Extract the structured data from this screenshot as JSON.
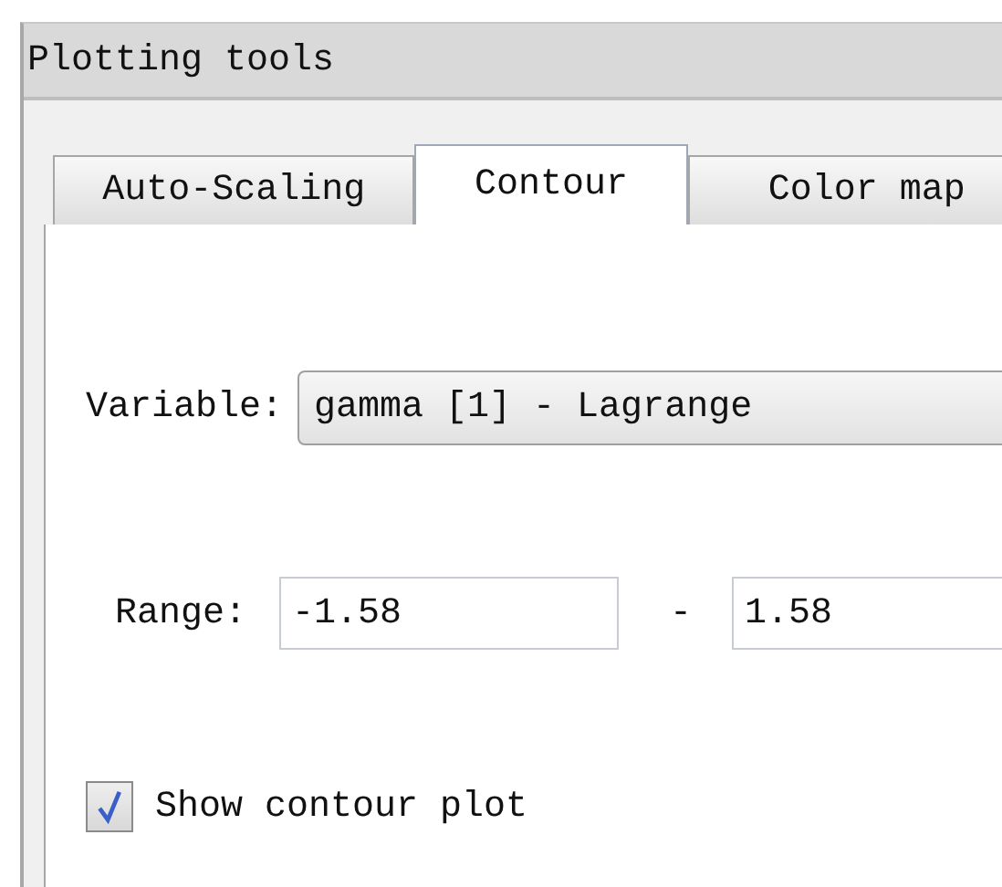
{
  "window": {
    "title": "Plotting tools"
  },
  "tabs": [
    {
      "label": "Auto-Scaling",
      "selected": false
    },
    {
      "label": "Contour",
      "selected": true
    },
    {
      "label": "Color map",
      "selected": false
    }
  ],
  "variable": {
    "label": "Variable:",
    "value": "gamma [1] - Lagrange"
  },
  "range": {
    "label": "Range:",
    "min": "-1.58",
    "separator": "-",
    "max": "1.58"
  },
  "show_contour": {
    "label": "Show contour plot",
    "checked": true
  }
}
